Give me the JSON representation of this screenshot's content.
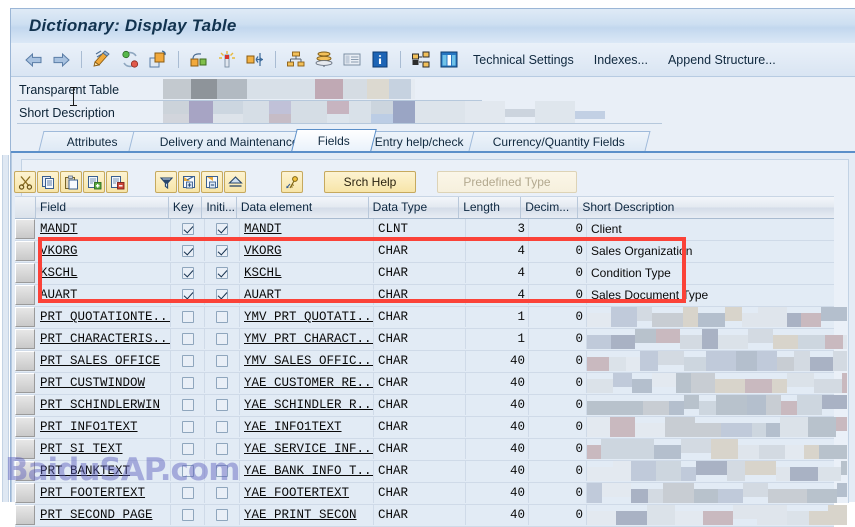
{
  "window": {
    "title": "Dictionary: Display Table"
  },
  "toolbar": {
    "icons": [
      {
        "name": "back-arrow-icon"
      },
      {
        "name": "forward-arrow-icon"
      },
      {
        "name": "display-change-pencil-icon"
      },
      {
        "name": "check-syntax-icon"
      },
      {
        "name": "activate-icon"
      },
      {
        "name": "where-used-list-icon"
      },
      {
        "name": "generate-icon"
      },
      {
        "name": "expand-network-icon"
      },
      {
        "name": "hierarchy-display-icon"
      },
      {
        "name": "database-utility-icon"
      },
      {
        "name": "list-display-icon"
      },
      {
        "name": "information-icon"
      },
      {
        "name": "structure-display-icon"
      },
      {
        "name": "table-contents-icon"
      }
    ],
    "links": [
      "Technical Settings",
      "Indexes...",
      "Append Structure..."
    ]
  },
  "attributes": {
    "label_table": "Transparent Table",
    "label_description": "Short Description",
    "value_table": "",
    "value_description": ""
  },
  "tabs": [
    {
      "label": "Attributes",
      "active": false
    },
    {
      "label": "Delivery and Maintenance",
      "active": false
    },
    {
      "label": "Fields",
      "active": true
    },
    {
      "label": "Entry help/check",
      "active": false
    },
    {
      "label": "Currency/Quantity Fields",
      "active": false
    }
  ],
  "grid_toolbar": {
    "buttons": [
      {
        "name": "cut-button",
        "icon": "scissors-icon",
        "label": "",
        "disabled": false
      },
      {
        "name": "copy-button",
        "icon": "copy-icon",
        "label": "",
        "disabled": false
      },
      {
        "name": "paste-button",
        "icon": "paste-icon",
        "label": "",
        "disabled": false
      },
      {
        "name": "insert-row-button",
        "icon": "insert-row-icon",
        "label": "",
        "disabled": false
      },
      {
        "name": "delete-row-button",
        "icon": "delete-row-icon",
        "label": "",
        "disabled": false
      },
      {
        "name": "filter-button",
        "icon": "funnel-icon",
        "label": "",
        "disabled": false
      },
      {
        "name": "append-row-button",
        "icon": "append-row-icon",
        "label": "",
        "disabled": false
      },
      {
        "name": "remove-row-button",
        "icon": "remove-row-icon",
        "label": "",
        "disabled": false
      },
      {
        "name": "sort-up-button",
        "icon": "sort-ascending-icon",
        "label": "",
        "disabled": false
      },
      {
        "name": "data-element-button",
        "icon": "key-pencil-icon",
        "label": "",
        "disabled": false
      },
      {
        "name": "srch-help-button",
        "icon": "",
        "label": "Srch Help",
        "disabled": false
      },
      {
        "name": "predefined-type-button",
        "icon": "",
        "label": "Predefined Type",
        "disabled": true
      }
    ]
  },
  "table": {
    "columns": [
      "Field",
      "Key",
      "Initi...",
      "Data element",
      "Data Type",
      "Length",
      "Decim...",
      "Short Description"
    ],
    "rows": [
      {
        "field": "MANDT",
        "key": true,
        "init": true,
        "data_element": "MANDT",
        "data_type": "CLNT",
        "length": "3",
        "decimals": "0",
        "description": "Client",
        "highlighted": false,
        "redacted": false
      },
      {
        "field": "VKORG",
        "key": true,
        "init": true,
        "data_element": "VKORG",
        "data_type": "CHAR",
        "length": "4",
        "decimals": "0",
        "description": "Sales Organization",
        "highlighted": true,
        "redacted": false
      },
      {
        "field": "KSCHL",
        "key": true,
        "init": true,
        "data_element": "KSCHL",
        "data_type": "CHAR",
        "length": "4",
        "decimals": "0",
        "description": "Condition Type",
        "highlighted": true,
        "redacted": false
      },
      {
        "field": "AUART",
        "key": true,
        "init": true,
        "data_element": "AUART",
        "data_type": "CHAR",
        "length": "4",
        "decimals": "0",
        "description": "Sales Document Type",
        "highlighted": true,
        "redacted": false
      },
      {
        "field": "PRT_QUOTATIONTE...",
        "key": false,
        "init": false,
        "data_element": "YMV_PRT_QUOTATI...",
        "data_type": "CHAR",
        "length": "1",
        "decimals": "0",
        "description": "",
        "highlighted": false,
        "redacted": true
      },
      {
        "field": "PRT_CHARACTERIS...",
        "key": false,
        "init": false,
        "data_element": "YMV_PRT_CHARACT...",
        "data_type": "CHAR",
        "length": "1",
        "decimals": "0",
        "description": "",
        "highlighted": false,
        "redacted": true
      },
      {
        "field": "PRT_SALES_OFFICE",
        "key": false,
        "init": false,
        "data_element": "YMV_SALES_OFFIC...",
        "data_type": "CHAR",
        "length": "40",
        "decimals": "0",
        "description": "",
        "highlighted": false,
        "redacted": true
      },
      {
        "field": "PRT_CUSTWINDOW",
        "key": false,
        "init": false,
        "data_element": "YAE_CUSTOMER_RE...",
        "data_type": "CHAR",
        "length": "40",
        "decimals": "0",
        "description": "",
        "highlighted": false,
        "redacted": true
      },
      {
        "field": "PRT_SCHINDLERWIN",
        "key": false,
        "init": false,
        "data_element": "YAE_SCHINDLER_R...",
        "data_type": "CHAR",
        "length": "40",
        "decimals": "0",
        "description": "",
        "highlighted": false,
        "redacted": true
      },
      {
        "field": "PRT_INFO1TEXT",
        "key": false,
        "init": false,
        "data_element": "YAE_INFO1TEXT",
        "data_type": "CHAR",
        "length": "40",
        "decimals": "0",
        "description": "",
        "highlighted": false,
        "redacted": true
      },
      {
        "field": "PRT_SI_TEXT",
        "key": false,
        "init": false,
        "data_element": "YAE_SERVICE_INF...",
        "data_type": "CHAR",
        "length": "40",
        "decimals": "0",
        "description": "",
        "highlighted": false,
        "redacted": true
      },
      {
        "field": "PRT_BANKTEXT",
        "key": false,
        "init": false,
        "data_element": "YAE_BANK_INFO_T...",
        "data_type": "CHAR",
        "length": "40",
        "decimals": "0",
        "description": "",
        "highlighted": false,
        "redacted": true
      },
      {
        "field": "PRT_FOOTERTEXT",
        "key": false,
        "init": false,
        "data_element": "YAE_FOOTERTEXT",
        "data_type": "CHAR",
        "length": "40",
        "decimals": "0",
        "description": "",
        "highlighted": false,
        "redacted": true
      },
      {
        "field": "PRT_SECOND_PAGE",
        "key": false,
        "init": false,
        "data_element": "YAE_PRINT_SECON",
        "data_type": "CHAR",
        "length": "40",
        "decimals": "0",
        "description": "",
        "highlighted": false,
        "redacted": true
      }
    ]
  },
  "annotation": {
    "highlight_color": "#fb4238",
    "highlight_rows": [
      "VKORG",
      "KSCHL",
      "AUART"
    ]
  },
  "watermark": {
    "text": "BaiduSAP.com",
    "color": "#5d5fbe"
  }
}
